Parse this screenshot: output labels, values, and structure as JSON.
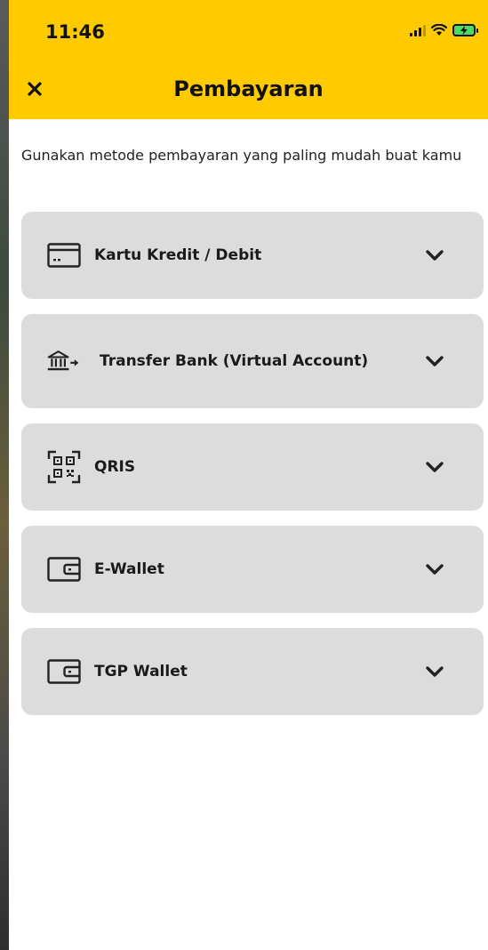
{
  "status_bar": {
    "time": "11:46",
    "signal_icon": "cellular-signal-icon",
    "wifi_icon": "wifi-icon",
    "battery_icon": "battery-charging-icon"
  },
  "header": {
    "title": "Pembayaran",
    "close_icon": "close-icon",
    "background_color": "#ffca00"
  },
  "subtitle": "Gunakan metode pembayaran yang paling mudah buat kamu",
  "payment_methods": [
    {
      "label": "Kartu Kredit / Debit",
      "icon": "credit-card-icon",
      "expand_icon": "chevron-down-icon"
    },
    {
      "label": "Transfer Bank (Virtual Account)",
      "icon": "bank-transfer-icon",
      "expand_icon": "chevron-down-icon"
    },
    {
      "label": "QRIS",
      "icon": "qr-code-icon",
      "expand_icon": "chevron-down-icon"
    },
    {
      "label": "E-Wallet",
      "icon": "wallet-icon",
      "expand_icon": "chevron-down-icon"
    },
    {
      "label": "TGP Wallet",
      "icon": "wallet-icon",
      "expand_icon": "chevron-down-icon"
    }
  ],
  "colors": {
    "accent": "#ffca00",
    "card_background": "#dcdcdc",
    "text": "#1a1a1a"
  }
}
